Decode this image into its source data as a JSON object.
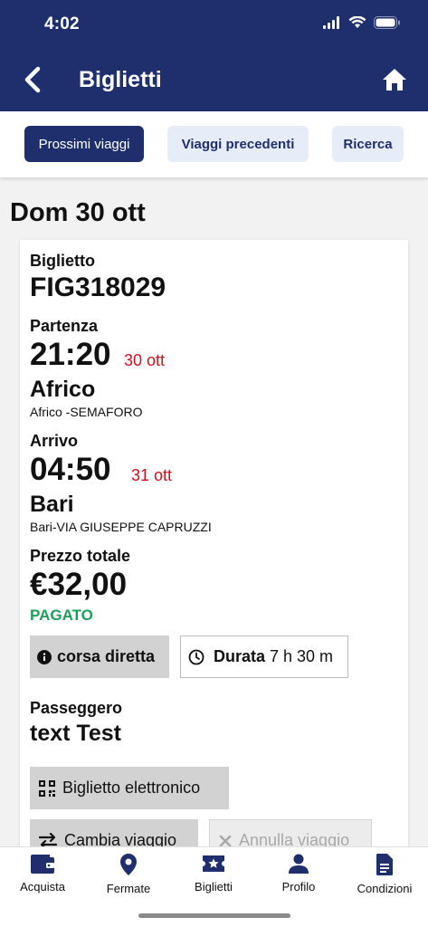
{
  "status_bar": {
    "time": "4:02"
  },
  "header": {
    "title": "Biglietti"
  },
  "tabs": [
    {
      "label": "Prossimi viaggi"
    },
    {
      "label": "Viaggi precedenti"
    },
    {
      "label": "Ricerca"
    }
  ],
  "date_heading": "Dom 30 ott",
  "ticket": {
    "label": "Biglietto",
    "code": "FIG318029",
    "departure": {
      "label": "Partenza",
      "time": "21:20",
      "date": "30 ott",
      "city": "Africo",
      "stop": "Africo -SEMAFORO"
    },
    "arrival": {
      "label": "Arrivo",
      "time": "04:50",
      "date": "31 ott",
      "city": "Bari",
      "stop": "Bari-VIA GIUSEPPE CAPRUZZI"
    },
    "price": {
      "label": "Prezzo totale",
      "value": "€32,00",
      "status": "PAGATO"
    },
    "direct_label": "corsa diretta",
    "duration": {
      "label": "Durata",
      "value": "7 h 30 m"
    },
    "passenger": {
      "label": "Passeggero",
      "name": "text Test"
    },
    "buttons": {
      "eticket": "Biglietto elettronico",
      "change": "Cambia viaggio",
      "cancel": "Annulla viaggio"
    }
  },
  "bottom_nav": [
    {
      "label": "Acquista",
      "icon": "wallet-icon"
    },
    {
      "label": "Fermate",
      "icon": "map-pin-icon"
    },
    {
      "label": "Biglietti",
      "icon": "ticket-star-icon"
    },
    {
      "label": "Profilo",
      "icon": "user-icon"
    },
    {
      "label": "Condizioni",
      "icon": "document-icon"
    }
  ],
  "colors": {
    "primary": "#1f2f6e",
    "tab_inactive_bg": "#e6edf8",
    "date_red": "#d0111b",
    "paid_green": "#1aa157"
  }
}
